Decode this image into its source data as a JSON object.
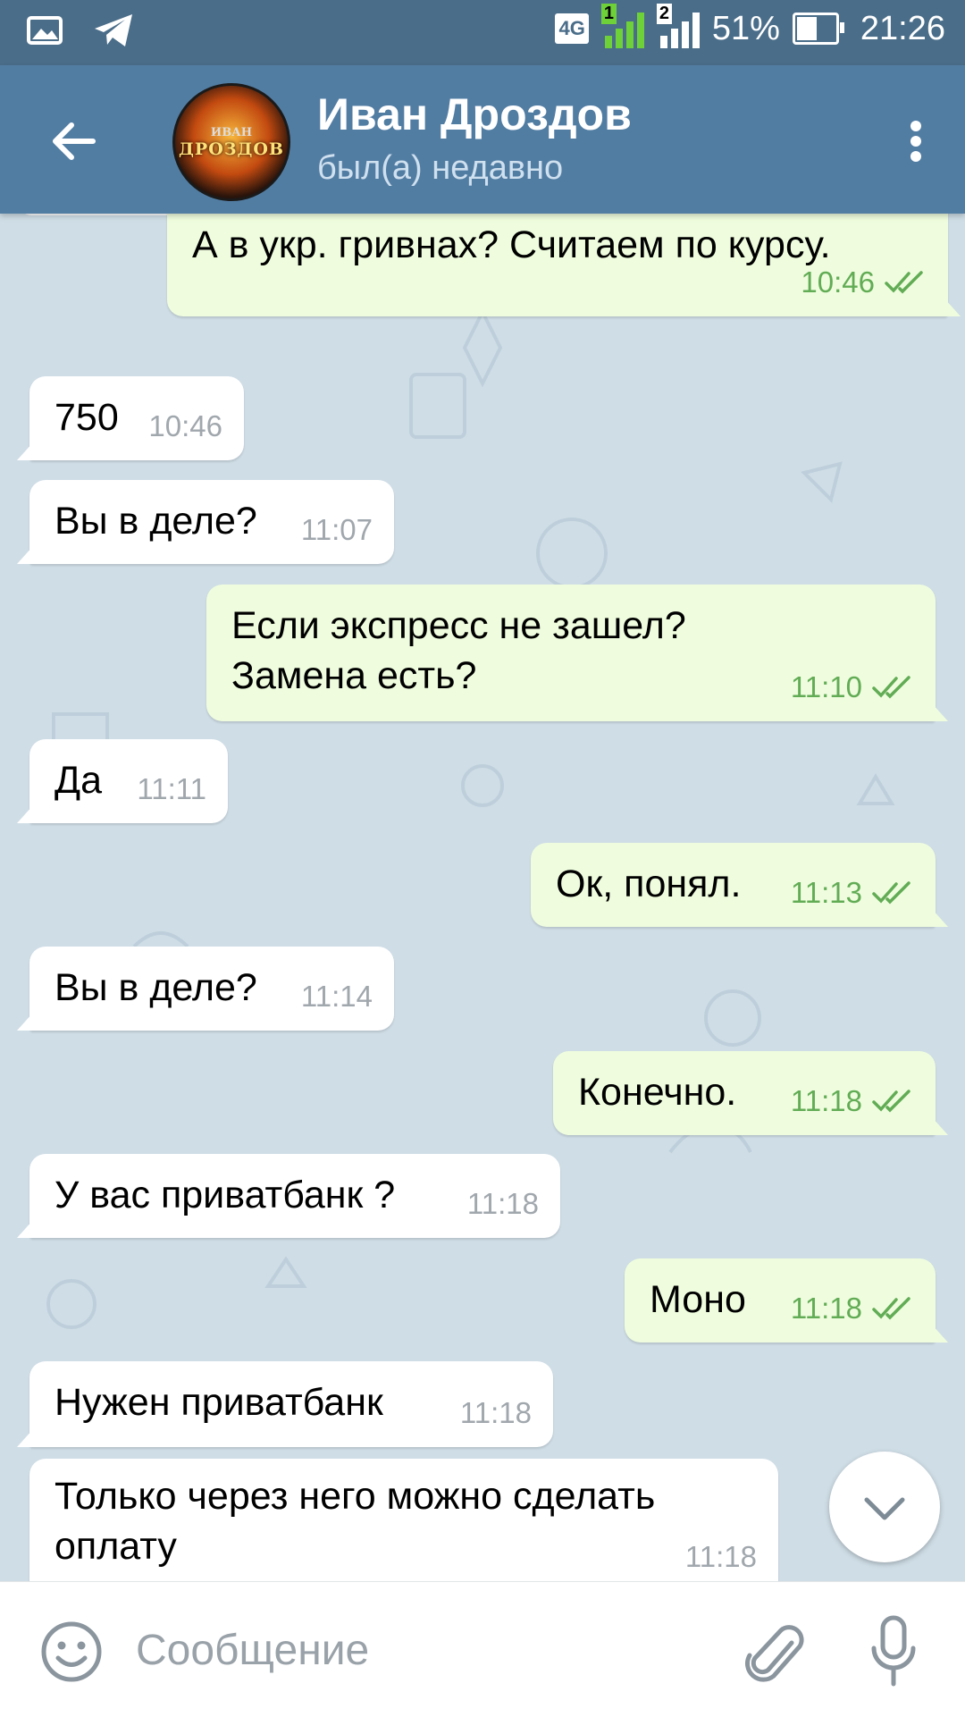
{
  "status_bar": {
    "network": "4G",
    "sim1": "1",
    "sim2": "2",
    "battery": "51%",
    "time": "21:26"
  },
  "header": {
    "contact_name": "Иван Дроздов",
    "contact_status": "был(а) недавно",
    "avatar_text_top": "ИВАН",
    "avatar_text_main": "ДРОЗДОВ"
  },
  "messages": [
    {
      "dir": "out",
      "text": "А в укр. гривнах? Считаем по курсу.",
      "time": "10:46",
      "read": true
    },
    {
      "dir": "in",
      "text": "750",
      "time": "10:46"
    },
    {
      "dir": "in",
      "text": "Вы в деле?",
      "time": "11:07"
    },
    {
      "dir": "out",
      "text": "Если экспресс не зашел? Замена есть?",
      "time": "11:10",
      "read": true
    },
    {
      "dir": "in",
      "text": "Да",
      "time": "11:11"
    },
    {
      "dir": "out",
      "text": "Ок, понял.",
      "time": "11:13",
      "read": true
    },
    {
      "dir": "in",
      "text": "Вы в деле?",
      "time": "11:14"
    },
    {
      "dir": "out",
      "text": "Конечно.",
      "time": "11:18",
      "read": true
    },
    {
      "dir": "in",
      "text": "У вас приватбанк ?",
      "time": "11:18"
    },
    {
      "dir": "out",
      "text": "Моно",
      "time": "11:18",
      "read": true
    },
    {
      "dir": "in",
      "text": "Нужен приватбанк",
      "time": "11:18"
    },
    {
      "dir": "in",
      "text": "Только через него можно сделать оплату",
      "time": "11:18"
    }
  ],
  "composer": {
    "placeholder": "Сообщение"
  },
  "colors": {
    "header_bg": "#527da3",
    "status_bg": "#4a6d89",
    "chat_bg": "#cfdde6",
    "incoming_bubble": "#ffffff",
    "outgoing_bubble": "#effdde",
    "outgoing_meta": "#62ac55"
  },
  "icons": [
    "back-arrow-icon",
    "more-vertical-icon",
    "double-check-icon",
    "chevron-down-icon",
    "emoji-icon",
    "paperclip-icon",
    "microphone-icon",
    "gallery-icon",
    "telegram-icon",
    "battery-icon",
    "signal-icon"
  ]
}
